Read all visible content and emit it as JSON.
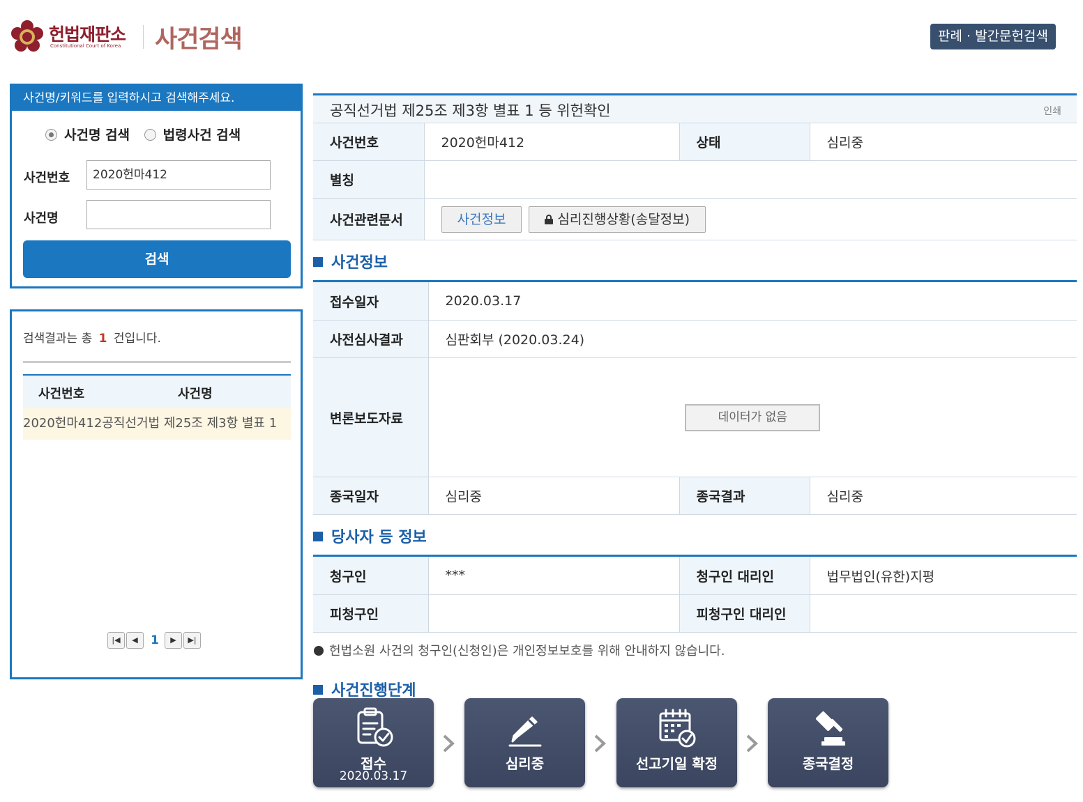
{
  "header": {
    "court_name": "헌법재판소",
    "court_name_en": "Constitutional Court of Korea",
    "page_title": "사건검색",
    "top_button": "판례 · 발간문헌검색"
  },
  "search": {
    "instruction": "사건명/키워드를 입력하시고 검색해주세요.",
    "radio_case_name": "사건명 검색",
    "radio_law_case": "법령사건 검색",
    "selected_mode": "사건명 검색",
    "case_number_label": "사건번호",
    "case_number_value": "2020헌마412",
    "case_name_label": "사건명",
    "case_name_value": "",
    "search_button": "검색"
  },
  "results": {
    "summary_prefix": "검색결과는 총",
    "count": "1",
    "summary_suffix": "건입니다.",
    "columns": [
      "사건번호",
      "사건명"
    ],
    "rows": [
      {
        "case_number": "2020헌마412",
        "case_name": "공직선거법 제25조 제3항 별표 1"
      }
    ],
    "current_page": "1"
  },
  "case": {
    "title": "공직선거법 제25조 제3항 별표 1 등 위헌확인",
    "print_link": "인쇄",
    "number_label": "사건번호",
    "number_value": "2020헌마412",
    "status_label": "상태",
    "status_value": "심리중",
    "alias_label": "별칭",
    "alias_value": "",
    "docs_label": "사건관련문서",
    "doc_case_info": "사건정보",
    "doc_progress": "심리진행상황(송달정보)"
  },
  "case_info": {
    "section_title": "사건정보",
    "filing_date_label": "접수일자",
    "filing_date_value": "2020.03.17",
    "pre_review_label": "사전심사결과",
    "pre_review_value": "심판회부 (2020.03.24)",
    "press_label": "변론보도자료",
    "press_value": "데이터가 없음",
    "final_date_label": "종국일자",
    "final_date_value": "심리중",
    "final_result_label": "종국결과",
    "final_result_value": "심리중"
  },
  "parties": {
    "section_title": "당사자 등 정보",
    "petitioner_label": "청구인",
    "petitioner_value": "***",
    "petitioner_agent_label": "청구인 대리인",
    "petitioner_agent_value": "법무법인(유한)지평",
    "respondent_label": "피청구인",
    "respondent_value": "",
    "respondent_agent_label": "피청구인 대리인",
    "respondent_agent_value": "",
    "notice": "헌법소원 사건의 청구인(신청인)은 개인정보보호를 위해 안내하지 않습니다."
  },
  "progress": {
    "section_title": "사건진행단계",
    "steps": [
      {
        "label": "접수",
        "date": "2020.03.17",
        "icon": "document-check-icon"
      },
      {
        "label": "심리중",
        "date": "",
        "icon": "pencil-icon"
      },
      {
        "label": "선고기일 확정",
        "date": "",
        "icon": "calendar-check-icon"
      },
      {
        "label": "종국결정",
        "date": "",
        "icon": "gavel-icon"
      }
    ]
  },
  "colors": {
    "primary_blue": "#1b77c0",
    "brand_red": "#8f1f2d",
    "step_bg": "#434e68",
    "results_count": "#c0392b"
  }
}
